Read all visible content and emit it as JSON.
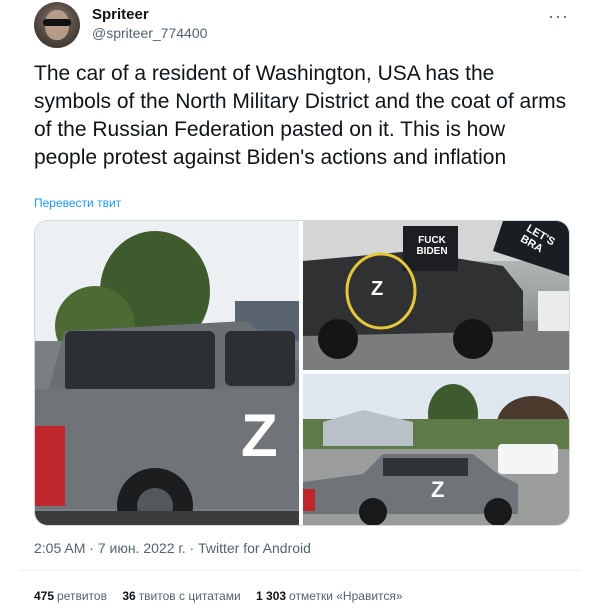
{
  "author": {
    "name": "Spriteer",
    "handle": "@spriteer_774400"
  },
  "more_icon": "more-horizontal-icon",
  "tweet_text": "The car of a resident of Washington, USA has the symbols of the North Military District and the coat of arms of the Russian Federation pasted on it. This is how people protest against Biden's actions and inflation",
  "translate_label": "Перевести твит",
  "photos": {
    "sign_text": "FUCK BIDEN",
    "flag_text": "LET'S BRA",
    "letter_z": "Z"
  },
  "meta": {
    "time": "2:05 AM",
    "date": "7 июн. 2022 г.",
    "source": "Twitter for Android"
  },
  "stats": {
    "retweets_count": "475",
    "retweets_label": "ретвитов",
    "quotes_count": "36",
    "quotes_label": "твитов с цитатами",
    "likes_count": "1 303",
    "likes_label": "отметки «Нравится»"
  },
  "colors": {
    "link": "#1d9bf0",
    "secondary": "#536471",
    "highlight_circle": "#e7c83b"
  }
}
